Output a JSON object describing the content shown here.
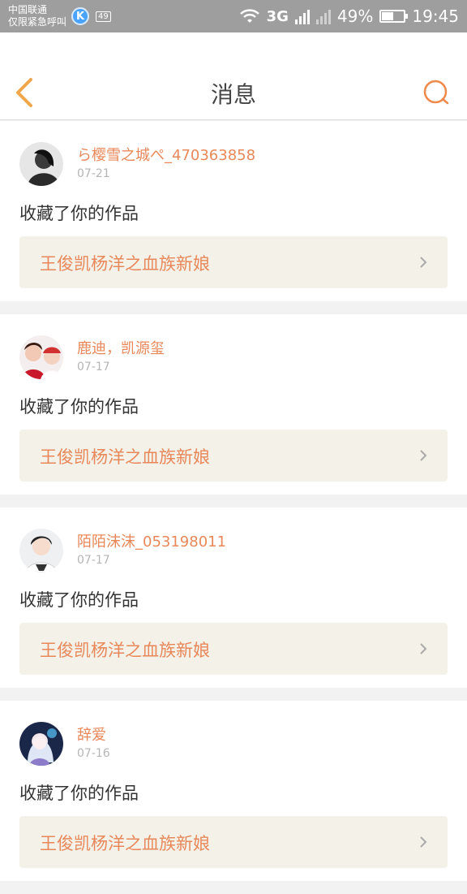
{
  "status_bar": {
    "carrier": "中国联通",
    "emergency": "仅限紧急呼叫",
    "k_app": "K",
    "badge": "49",
    "network": "3G",
    "battery_text": "49%",
    "battery_level": 0.49,
    "time": "19:45"
  },
  "header": {
    "title": "消息",
    "accent_color": "#f08a4b"
  },
  "messages": [
    {
      "username": "ら樱雪之城ぺ_470363858",
      "date": "07-21",
      "action": "收藏了你的作品",
      "work": "王俊凯杨洋之血族新娘"
    },
    {
      "username": "鹿迪，凯源玺",
      "date": "07-17",
      "action": "收藏了你的作品",
      "work": "王俊凯杨洋之血族新娘"
    },
    {
      "username": "陌陌沫沫_053198011",
      "date": "07-17",
      "action": "收藏了你的作品",
      "work": "王俊凯杨洋之血族新娘"
    },
    {
      "username": "辞爱",
      "date": "07-16",
      "action": "收藏了你的作品",
      "work": "王俊凯杨洋之血族新娘"
    }
  ]
}
